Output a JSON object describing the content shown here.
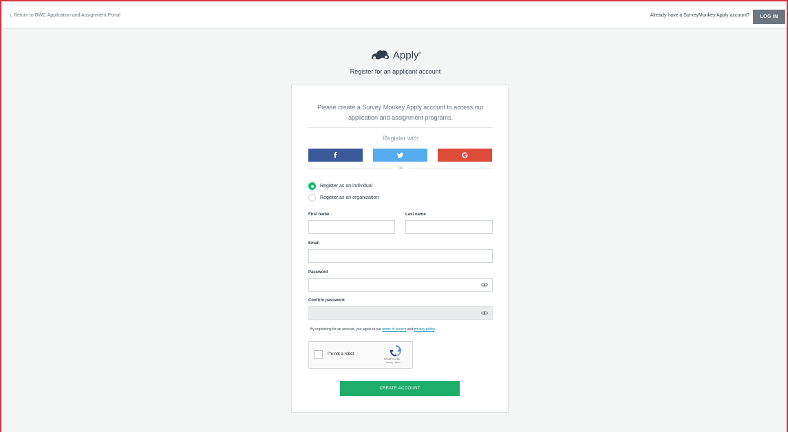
{
  "topbar": {
    "back_link": "Return to BWC Application and Assignment Portal",
    "login_prompt": "Already have a SurveyMonkey Apply account?",
    "login_button": "LOG IN"
  },
  "brand": {
    "name": "Apply",
    "trademark": "®",
    "subtitle": "Register for an applicant account"
  },
  "card": {
    "intro": "Please create a Survey Monkey Apply account to access our application and assignment programs.",
    "register_with": "Register with",
    "social": [
      {
        "name": "facebook",
        "color": "#3b5998"
      },
      {
        "name": "twitter",
        "color": "#55acee"
      },
      {
        "name": "google",
        "color": "#dd4b39"
      }
    ],
    "or_label": "OR",
    "account_types": [
      {
        "label": "Register as an individual",
        "selected": true
      },
      {
        "label": "Register as an organization",
        "selected": false
      }
    ],
    "fields": {
      "first_name": {
        "label": "First name",
        "value": ""
      },
      "last_name": {
        "label": "Last name",
        "value": ""
      },
      "email": {
        "label": "Email",
        "value": ""
      },
      "password": {
        "label": "Password",
        "value": ""
      },
      "confirm_password": {
        "label": "Confirm password",
        "value": ""
      }
    },
    "terms": {
      "prefix": "By registering for an account, you agree to our",
      "tos_link": "terms of service",
      "conjunction": "and",
      "privacy_link": "privacy policy",
      "suffix": "."
    },
    "captcha": {
      "label": "I'm not a robot",
      "brand": "reCAPTCHA",
      "terms": "Privacy - Terms"
    },
    "submit": "CREATE ACCOUNT"
  },
  "colors": {
    "accent_green": "#1ead6a",
    "radio_green": "#00bf6f",
    "frame_border": "#d9323f",
    "link_blue": "#007faa"
  }
}
